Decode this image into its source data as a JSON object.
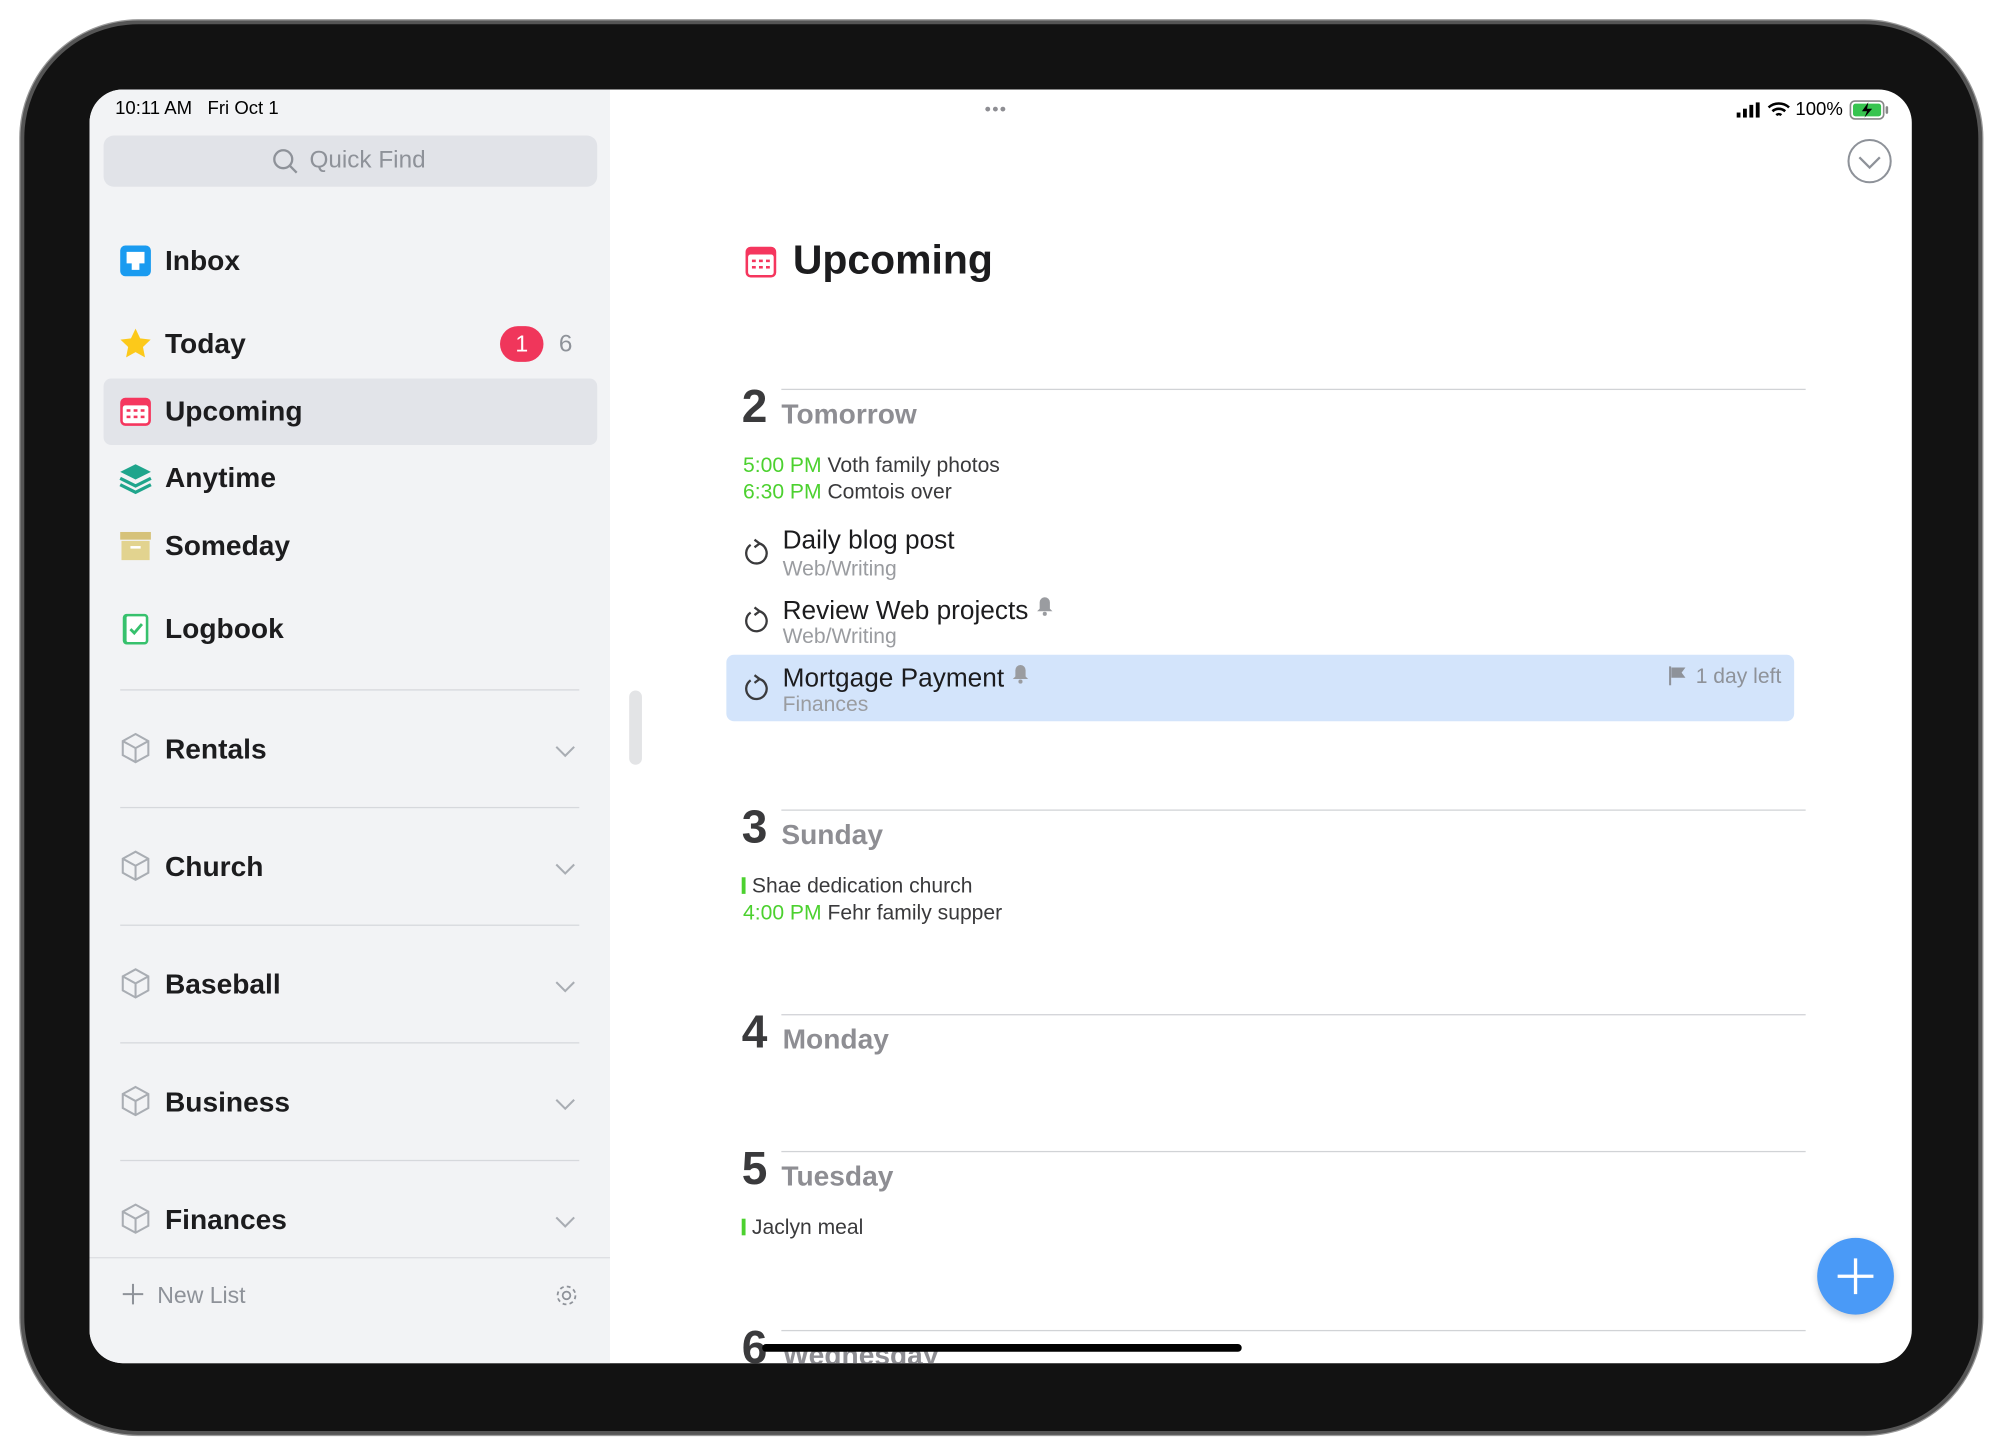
{
  "status_bar": {
    "time": "10:11 AM",
    "date": "Fri Oct 1",
    "battery": "100%",
    "dots": "•••"
  },
  "sidebar": {
    "search_placeholder": "Quick Find",
    "nav": [
      {
        "label": "Inbox",
        "icon": "inbox-icon"
      },
      {
        "label": "Today",
        "icon": "star-icon",
        "badge": "1",
        "count": "6"
      },
      {
        "label": "Upcoming",
        "icon": "calendar-icon",
        "selected": true
      },
      {
        "label": "Anytime",
        "icon": "layers-icon"
      },
      {
        "label": "Someday",
        "icon": "archive-box-icon"
      },
      {
        "label": "Logbook",
        "icon": "logbook-icon"
      }
    ],
    "areas": [
      "Rentals",
      "Church",
      "Baseball",
      "Business",
      "Finances"
    ],
    "new_list": "New List"
  },
  "main": {
    "title": "Upcoming",
    "sections": [
      {
        "num": "2",
        "day": "Tomorrow",
        "events": [
          {
            "time": "5:00 PM",
            "title": "Voth family photos"
          },
          {
            "time": "6:30 PM",
            "title": "Comtois over"
          }
        ],
        "tasks": [
          {
            "title": "Daily blog post",
            "project": "Web/Writing",
            "repeat": true
          },
          {
            "title": "Review Web projects",
            "project": "Web/Writing",
            "repeat": true,
            "reminder": true
          },
          {
            "title": "Mortgage Payment",
            "project": "Finances",
            "repeat": true,
            "reminder": true,
            "deadline": "1 day left",
            "selected": true
          }
        ]
      },
      {
        "num": "3",
        "day": "Sunday",
        "events": [
          {
            "time": "",
            "title": "Shae dedication church",
            "all_day": true
          },
          {
            "time": "4:00 PM",
            "title": "Fehr family supper"
          }
        ]
      },
      {
        "num": "4",
        "day": "Monday"
      },
      {
        "num": "5",
        "day": "Tuesday",
        "events": [
          {
            "time": "",
            "title": "Jaclyn meal",
            "all_day": true
          }
        ]
      },
      {
        "num": "6",
        "day": "Wednesday"
      }
    ]
  },
  "colors": {
    "accent": "#4a9af7",
    "selection": "#d3e4fb",
    "event_time": "#4cd12f",
    "badge": "#f0365b"
  }
}
